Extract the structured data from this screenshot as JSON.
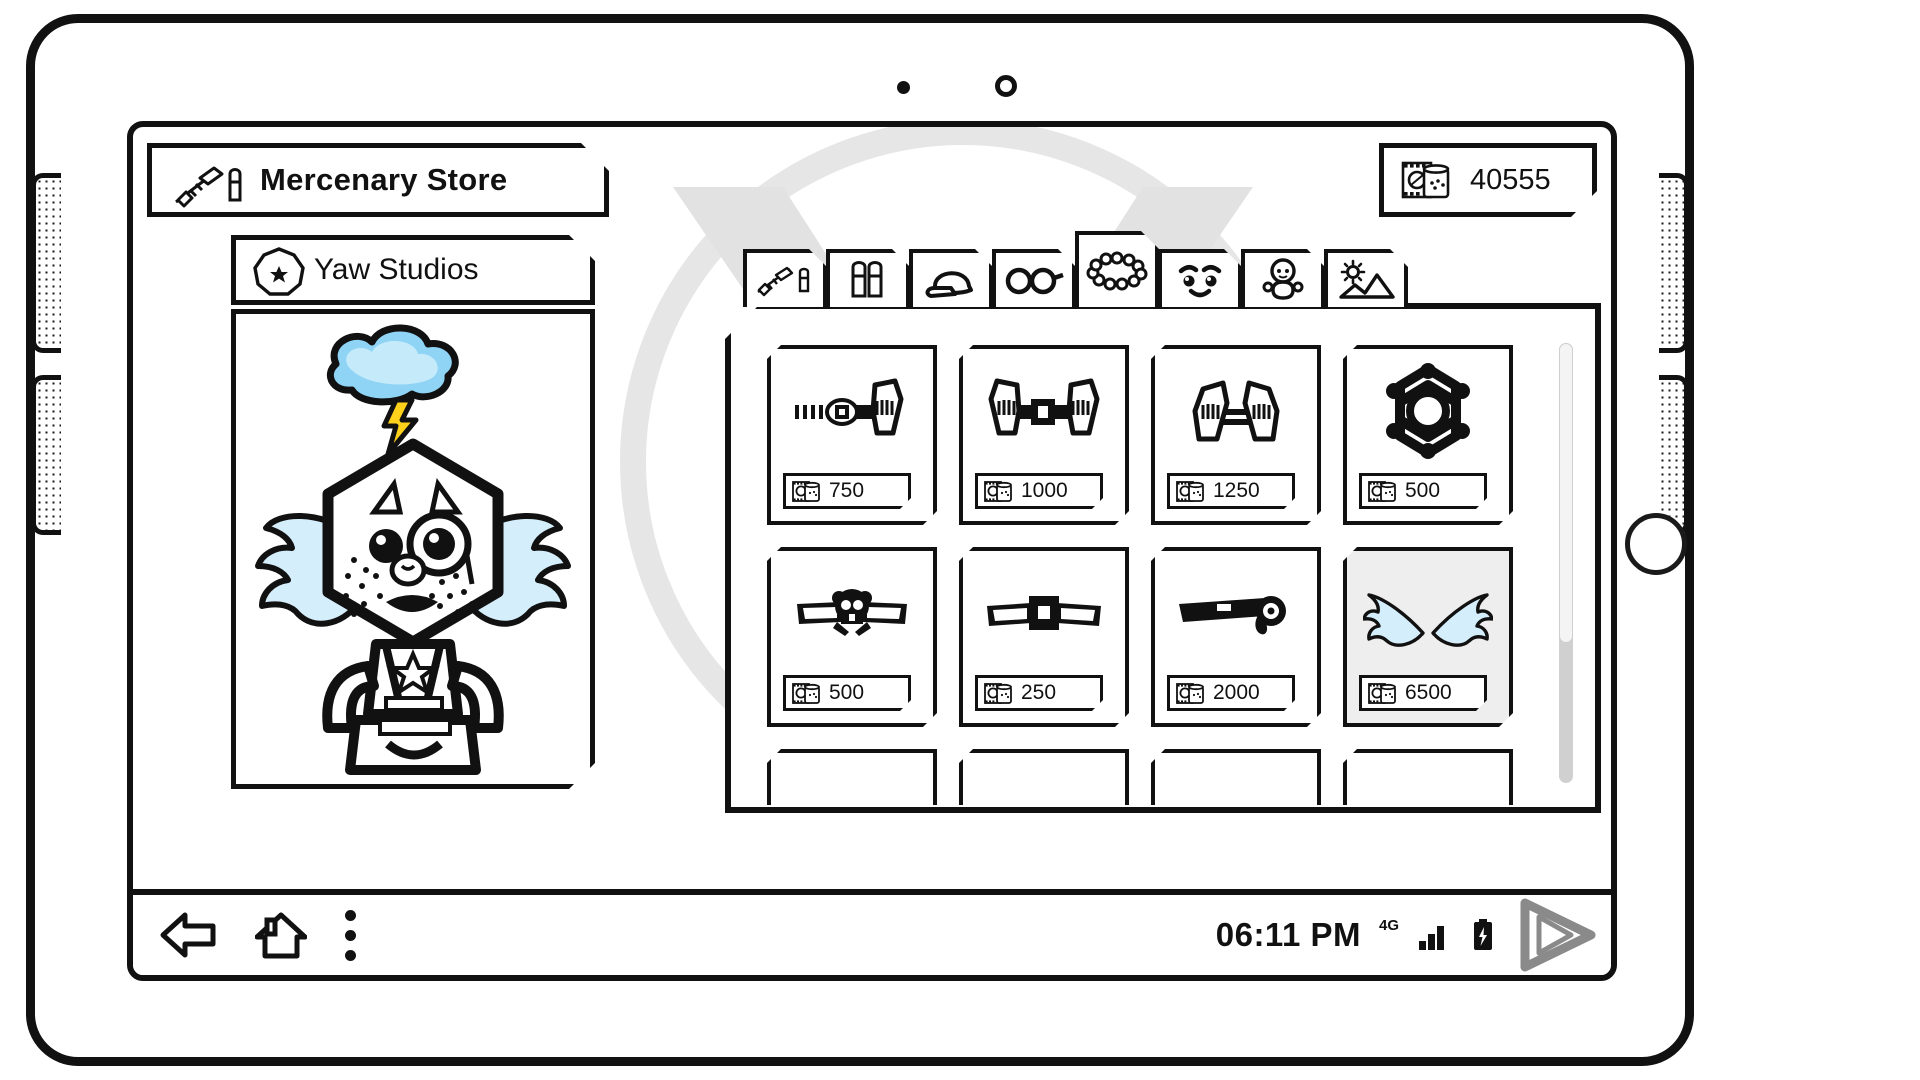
{
  "device": {
    "sensor_icon": "sensor-dot",
    "camera_icon": "front-camera",
    "speaker_icon": "speaker-grille",
    "home_button_icon": "home-button-ring"
  },
  "header": {
    "store_title": "Mercenary Store",
    "store_icon": "rifle-bullet-icon",
    "currency_amount": "40555",
    "currency_icon": "film-canister-icon"
  },
  "character_panel": {
    "studio_name": "Yaw Studios",
    "studio_badge_icon": "star-nonagon-icon",
    "avatar_icon": "hexagon-head-avatar",
    "avatar_features": [
      "storm-cloud",
      "lightning-bolt",
      "angry-eyebrows",
      "monocle",
      "freckles",
      "frown-mouth",
      "angel-wings",
      "sheriff-star-badge",
      "bandolier-straps"
    ]
  },
  "category_tabs": [
    {
      "id": "weapons",
      "icon": "rifle-bullet-icon",
      "active": false
    },
    {
      "id": "ammo",
      "icon": "bullets-icon",
      "active": false
    },
    {
      "id": "hats",
      "icon": "cap-icon",
      "active": false
    },
    {
      "id": "eyewear",
      "icon": "glasses-icon",
      "active": false
    },
    {
      "id": "accessories",
      "icon": "bead-necklace-icon",
      "active": true
    },
    {
      "id": "faces",
      "icon": "smiley-face-icon",
      "active": false
    },
    {
      "id": "bodies",
      "icon": "baby-body-icon",
      "active": false
    },
    {
      "id": "scenes",
      "icon": "sun-mountain-icon",
      "active": false
    }
  ],
  "items": [
    [
      {
        "name": "single-holster-belt",
        "art": "holster-right",
        "price": "750",
        "equipped": false
      },
      {
        "name": "dual-holster-belt",
        "art": "holster-dual",
        "price": "1000",
        "equipped": false
      },
      {
        "name": "twin-holster-rig",
        "art": "holster-twin",
        "price": "1250",
        "equipped": false
      },
      {
        "name": "sheriff-star-badge",
        "art": "sheriff-star",
        "price": "500",
        "equipped": false
      }
    ],
    [
      {
        "name": "skull-belt",
        "art": "belt-skull",
        "price": "500",
        "equipped": false
      },
      {
        "name": "plain-belt",
        "art": "belt-plain",
        "price": "250",
        "equipped": false
      },
      {
        "name": "lasso-belt",
        "art": "belt-lasso",
        "price": "2000",
        "equipped": false
      },
      {
        "name": "angel-wings",
        "art": "angel-wings",
        "price": "6500",
        "equipped": true
      }
    ]
  ],
  "nav_bar": {
    "back_icon": "back-arrow-icon",
    "home_icon": "home-icon",
    "menu_icon": "overflow-menu-icon",
    "time": "06:11 PM",
    "network_type": "4G",
    "signal_icon": "signal-bars-icon",
    "battery_icon": "battery-charging-icon",
    "play_icon": "play-triangle-icon"
  },
  "colors": {
    "ink": "#111111",
    "wing_fill": "#cfeaf9",
    "cloud_fill": "#8fd4f5",
    "bolt_fill": "#ffd11a",
    "equipped_bg": "#eeeeee",
    "watermark": "#e4e4e4",
    "play_gray": "#8a8a8a"
  }
}
